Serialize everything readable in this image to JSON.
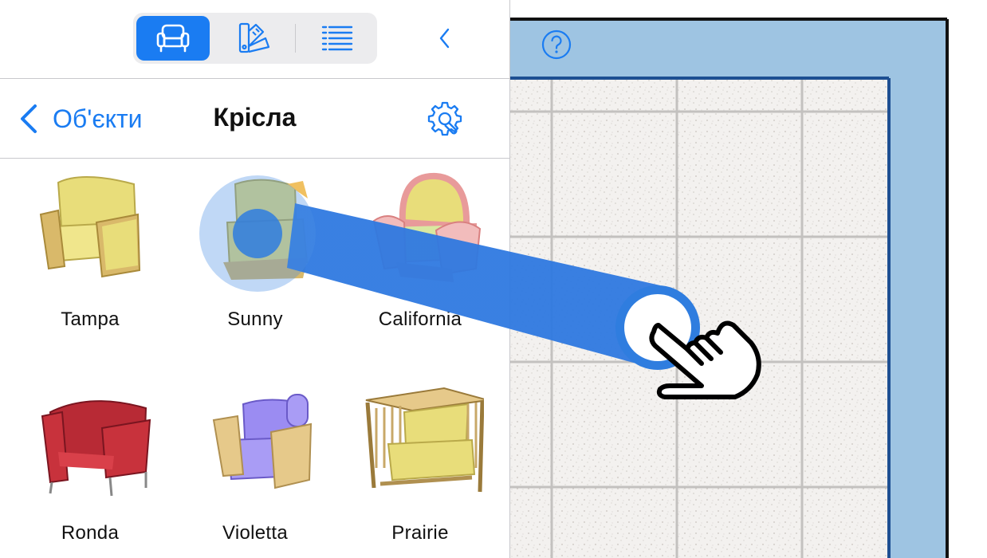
{
  "toolbar": {
    "tabs": [
      {
        "id": "objects",
        "icon": "armchair-icon",
        "active": true
      },
      {
        "id": "materials",
        "icon": "color-swatches-icon",
        "active": false
      },
      {
        "id": "list",
        "icon": "list-icon",
        "active": false
      }
    ],
    "collapse_icon": "chevron-left-icon"
  },
  "nav": {
    "back_label": "Об'єкти",
    "title": "Крісла",
    "settings_icon": "gear-wrench-icon"
  },
  "items": [
    {
      "label": "Tampa",
      "color": "#e8dd7a"
    },
    {
      "label": "Sunny",
      "color": "#e8dd7a"
    },
    {
      "label": "California",
      "color": "#eea0a0"
    },
    {
      "label": "Ronda",
      "color": "#c8323c"
    },
    {
      "label": "Violetta",
      "color": "#9b8cf2"
    },
    {
      "label": "Prairie",
      "color": "#e8dd7a"
    }
  ],
  "canvas": {
    "help_icon": "question-circle-icon",
    "gesture_icon": "hand-pointer-icon",
    "wall_color": "#9ec4e2"
  },
  "colors": {
    "accent": "#1a7cf2"
  }
}
